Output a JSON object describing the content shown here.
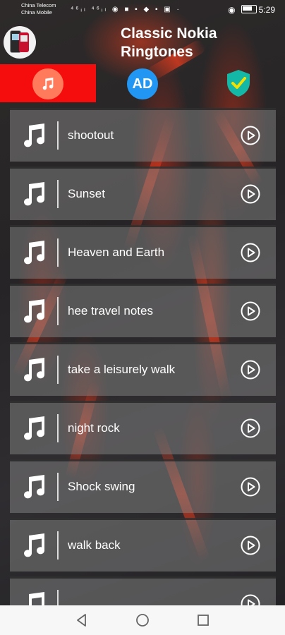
{
  "status_bar": {
    "carrier_1": "China Telecom",
    "carrier_2": "China Mobile",
    "icons": "⁴⁶ᵢₗ ⁴⁶ᵢₗ ◉ ■ ▪ ◆ ▪ ▣ ·",
    "battery": "",
    "time": "5:29"
  },
  "header": {
    "title_line1": "Classic Nokia",
    "title_line2": "Ringtones"
  },
  "tabs": {
    "ad_label": "AD"
  },
  "ringtones": [
    {
      "title": "shootout"
    },
    {
      "title": "Sunset"
    },
    {
      "title": "Heaven and Earth"
    },
    {
      "title": "hee travel notes"
    },
    {
      "title": "take a leisurely walk"
    },
    {
      "title": "night rock"
    },
    {
      "title": "Shock swing"
    },
    {
      "title": "walk back"
    },
    {
      "title": ""
    }
  ],
  "colors": {
    "active_tab": "#f50c0c",
    "music_circle": "#ff7b5c",
    "ad_circle": "#2196f3",
    "shield": "#14b8a6",
    "shield_check": "#f5e000"
  }
}
